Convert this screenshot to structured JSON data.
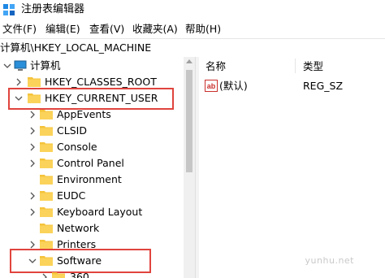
{
  "window": {
    "title": "注册表编辑器"
  },
  "menu": [
    "文件(F)",
    "编辑(E)",
    "查看(V)",
    "收藏夹(A)",
    "帮助(H)"
  ],
  "address": "计算机\\HKEY_LOCAL_MACHINE",
  "tree": {
    "root": "计算机",
    "hives": [
      "HKEY_CLASSES_ROOT",
      "HKEY_CURRENT_USER"
    ],
    "children": [
      "AppEvents",
      "CLSID",
      "Console",
      "Control Panel",
      "Environment",
      "EUDC",
      "Keyboard Layout",
      "Network",
      "Printers",
      "Software",
      "360"
    ]
  },
  "values_pane": {
    "columns": [
      "名称",
      "类型"
    ],
    "rows": [
      {
        "name": "(默认)",
        "type": "REG_SZ",
        "icon_text": "ab"
      }
    ]
  },
  "watermark": "yunhu.net",
  "colors": {
    "highlight": "#e0443e",
    "folder": "#f5c33b"
  }
}
